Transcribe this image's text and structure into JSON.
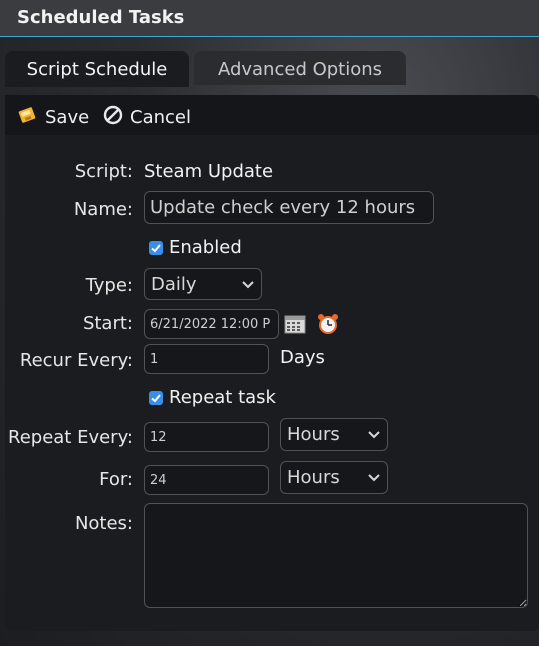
{
  "window": {
    "title": "Scheduled Tasks"
  },
  "tabs": [
    {
      "label": "Script Schedule",
      "active": true
    },
    {
      "label": "Advanced Options",
      "active": false
    }
  ],
  "toolbar": {
    "save_label": "Save",
    "cancel_label": "Cancel"
  },
  "form": {
    "script": {
      "label": "Script:",
      "value": "Steam Update"
    },
    "name": {
      "label": "Name:",
      "value": "Update check every 12 hours"
    },
    "enabled": {
      "label": "Enabled",
      "checked": true
    },
    "type": {
      "label": "Type:",
      "value": "Daily"
    },
    "start": {
      "label": "Start:",
      "value": "6/21/2022 12:00 P"
    },
    "recur": {
      "label": "Recur Every:",
      "value": "1",
      "unit": "Days"
    },
    "repeat_task": {
      "label": "Repeat task",
      "checked": true
    },
    "repeat_every": {
      "label": "Repeat Every:",
      "value": "12",
      "unit": "Hours"
    },
    "for": {
      "label": "For:",
      "value": "24",
      "unit": "Hours"
    },
    "notes": {
      "label": "Notes:",
      "value": ""
    }
  },
  "colors": {
    "accent": "#3fa7d6",
    "checkbox": "#3b8ee8"
  }
}
